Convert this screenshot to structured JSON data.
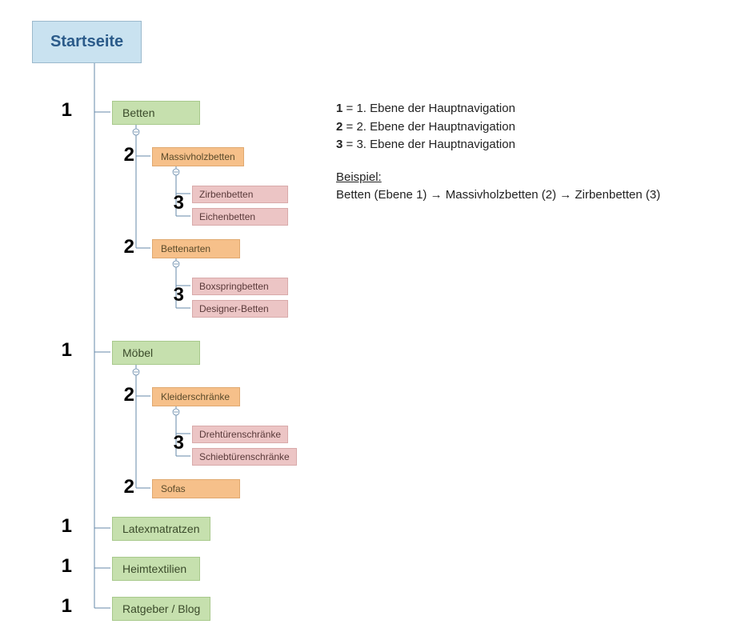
{
  "root": {
    "label": "Startseite"
  },
  "nodes": {
    "betten": "Betten",
    "massivholz": "Massivholzbetten",
    "zirben": "Zirbenbetten",
    "eichen": "Eichenbetten",
    "bettenarten": "Bettenarten",
    "boxspring": "Boxspringbetten",
    "designer": "Designer-Betten",
    "moebel": "Möbel",
    "kleider": "Kleiderschränke",
    "drehtuer": "Drehtürenschränke",
    "schiebe": "Schiebtürenschränke",
    "sofas": "Sofas",
    "latex": "Latexmatratzen",
    "heimtext": "Heimtextilien",
    "ratgeber": "Ratgeber / Blog"
  },
  "depthLabels": {
    "d1": "1",
    "d2": "2",
    "d3": "3"
  },
  "legend": {
    "line1_num": "1",
    "line1_text": " = 1. Ebene der Hauptnavigation",
    "line2_num": "2",
    "line2_text": " = 2. Ebene der Hauptnavigation",
    "line3_num": "3",
    "line3_text": " = 3. Ebene der Hauptnavigation",
    "example_head": "Beispiel:",
    "example_body": "Betten (Ebene 1) → Massivholzbetten (2) → Zirbenbetten (3)"
  }
}
